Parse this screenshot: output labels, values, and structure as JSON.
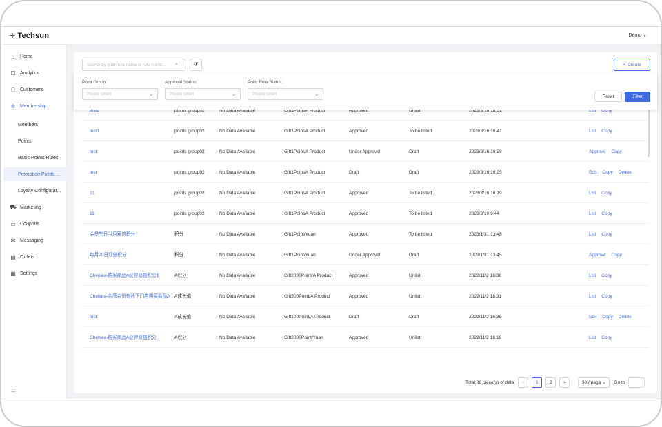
{
  "app": {
    "brand_icon": "techsun-logo-icon",
    "brand_name": "Techsun",
    "user_name": "Demo",
    "user_chevron": "chevron-down-icon"
  },
  "sidebar": {
    "items": [
      {
        "label": "Home",
        "icon": "home-icon",
        "glyph": "⌂"
      },
      {
        "label": "Analytics",
        "icon": "analytics-icon",
        "glyph": "☐"
      },
      {
        "label": "Customers",
        "icon": "customers-icon",
        "glyph": "⚇"
      },
      {
        "label": "Membership",
        "icon": "membership-icon",
        "glyph": "✲"
      },
      {
        "label": "Members"
      },
      {
        "label": "Points"
      },
      {
        "label": "Basic Points Rules"
      },
      {
        "label": "Promotion Points ..."
      },
      {
        "label": "Loyalty Configurat..."
      },
      {
        "label": "Marketing",
        "icon": "marketing-icon",
        "glyph": "⛟"
      },
      {
        "label": "Coupons",
        "icon": "coupons-icon",
        "glyph": "▭"
      },
      {
        "label": "Messaging",
        "icon": "messaging-icon",
        "glyph": "✉"
      },
      {
        "label": "Orders",
        "icon": "orders-icon",
        "glyph": "▤"
      },
      {
        "label": "Settings",
        "icon": "settings-icon",
        "glyph": "▦"
      }
    ],
    "active_item": "Promotion Points ...",
    "collapse_icon": "menu-collapse-icon"
  },
  "toolbar": {
    "search_placeholder": "Search by point rule name or rule numb...",
    "create_label": "Create"
  },
  "filters": {
    "point_group": {
      "label": "Point Group:",
      "placeholder": "Please select"
    },
    "approval_status": {
      "label": "Approval Status:",
      "placeholder": "Please select"
    },
    "point_rule_status": {
      "label": "Point Rule Status:",
      "placeholder": "Please select"
    },
    "reset_label": "Reset",
    "filter_label": "Filter"
  },
  "table": {
    "rows": [
      {
        "name": "test2",
        "group": "points group02",
        "desc": "No Data Available",
        "rule": "Gift1Point/A Product",
        "approval": "Approved",
        "status": "Unlist",
        "time": "2023/3/16 16:51",
        "ops": [
          "List",
          "Copy"
        ]
      },
      {
        "name": "test1",
        "group": "points group02",
        "desc": "No Data Available",
        "rule": "Gift1Point/A Product",
        "approval": "Approved",
        "status": "To be listed",
        "time": "2023/3/16 16:41",
        "ops": [
          "List",
          "Copy"
        ]
      },
      {
        "name": "test",
        "group": "points group02",
        "desc": "No Data Available",
        "rule": "Gift1Point/A Product",
        "approval": "Under Approval",
        "status": "Draft",
        "time": "2023/3/16 16:28",
        "ops": [
          "Approve",
          "Copy"
        ]
      },
      {
        "name": "test",
        "group": "points group02",
        "desc": "No Data Available",
        "rule": "Gift1Point/A Product",
        "approval": "Draft",
        "status": "Draft",
        "time": "2023/3/16 16:25",
        "ops": [
          "Edit",
          "Copy",
          "Delete"
        ]
      },
      {
        "name": "11",
        "group": "points group02",
        "desc": "No Data Available",
        "rule": "Gift1Point/A Product",
        "approval": "Approved",
        "status": "To be listed",
        "time": "2023/3/16 16:19",
        "ops": [
          "List",
          "Copy"
        ]
      },
      {
        "name": "11",
        "group": "points group02",
        "desc": "No Data Available",
        "rule": "Gift1Point/A Product",
        "approval": "Approved",
        "status": "To be listed",
        "time": "2023/3/10 9:44",
        "ops": [
          "List",
          "Copy"
        ]
      },
      {
        "name": "会员生日当月双倍积分",
        "group": "积分",
        "desc": "No Data Available",
        "rule": "Gift1Point/Yuan",
        "approval": "Approved",
        "status": "To be listed",
        "time": "2023/1/31 13:48",
        "ops": [
          "List",
          "Copy"
        ]
      },
      {
        "name": "每月20日双倍积分",
        "group": "积分",
        "desc": "No Data Available",
        "rule": "Gift1Point/Yuan",
        "approval": "Under Approval",
        "status": "Draft",
        "time": "2023/1/31 13:45",
        "ops": [
          "Approve",
          "Copy"
        ]
      },
      {
        "name": "Chelsea-购买商品A获得双倍积分1",
        "group": "A积分",
        "desc": "No Data Available",
        "rule": "Gift2000Point/A Product",
        "approval": "Approved",
        "status": "Unlist",
        "time": "2022/11/2 18:36",
        "ops": [
          "List",
          "Copy"
        ]
      },
      {
        "name": "Chelsea-金牌会员在线下门店购买商品A",
        "group": "A成长值",
        "desc": "No Data Available",
        "rule": "Gift500Point/A Product",
        "approval": "Approved",
        "status": "Unlist",
        "time": "2022/11/2 18:31",
        "ops": [
          "List",
          "Copy"
        ]
      },
      {
        "name": "test",
        "group": "A成长值",
        "desc": "No Data Available",
        "rule": "Gift100Point/A Product",
        "approval": "Draft",
        "status": "Draft",
        "time": "2022/11/2 16:39",
        "ops": [
          "Edit",
          "Copy",
          "Delete"
        ]
      },
      {
        "name": "Chelsea-购买商品A获得双倍积分",
        "group": "A积分",
        "desc": "No Data Available",
        "rule": "Gift2000Point/Yuan",
        "approval": "Approved",
        "status": "Unlist",
        "time": "2022/11/2 16:16",
        "ops": [
          "List",
          "Copy"
        ]
      }
    ]
  },
  "pagination": {
    "total_text": "Total 36 piece(s) of data",
    "pages": [
      "1",
      "2"
    ],
    "current_page": "1",
    "prev": "<",
    "next": ">",
    "page_size": "30 / page",
    "goto_label": "Go to"
  },
  "colors": {
    "accent": "#3e6ce0",
    "background": "#f0f2f5",
    "border": "#d9d9d9"
  }
}
